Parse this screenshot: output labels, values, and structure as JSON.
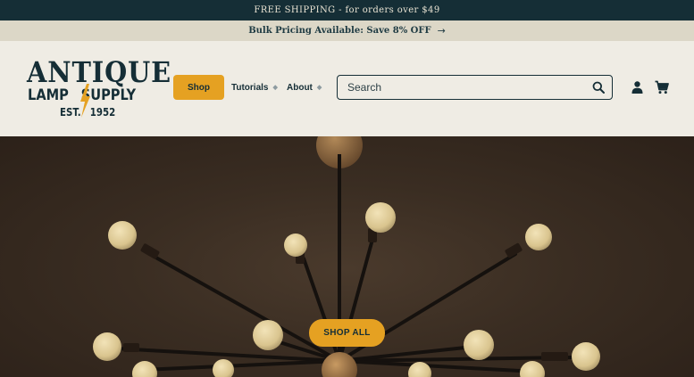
{
  "announcement": {
    "text": "FREE SHIPPING - for orders over $49"
  },
  "promo": {
    "text": "Bulk Pricing Available: Save 8% OFF",
    "arrow": "→"
  },
  "logo": {
    "line1": "ANTIQUE",
    "line2_left": "LAMP",
    "line2_right": "SUPPLY",
    "line3_left": "EST.",
    "line3_right": "1952",
    "icon": "lightning-bolt-icon"
  },
  "nav": {
    "shop": "Shop",
    "tutorials": "Tutorials",
    "about": "About",
    "dropdown_marker": "◆"
  },
  "search": {
    "placeholder": "Search",
    "icon": "search-icon"
  },
  "header_icons": {
    "account": "account-icon",
    "cart": "cart-icon"
  },
  "hero": {
    "cta": "SHOP ALL",
    "image": "sputnik-chandelier-photo"
  },
  "colors": {
    "dark": "#152e36",
    "accent": "#e5a122",
    "cream": "#efece4",
    "promo_bg": "#dcd7c7"
  }
}
